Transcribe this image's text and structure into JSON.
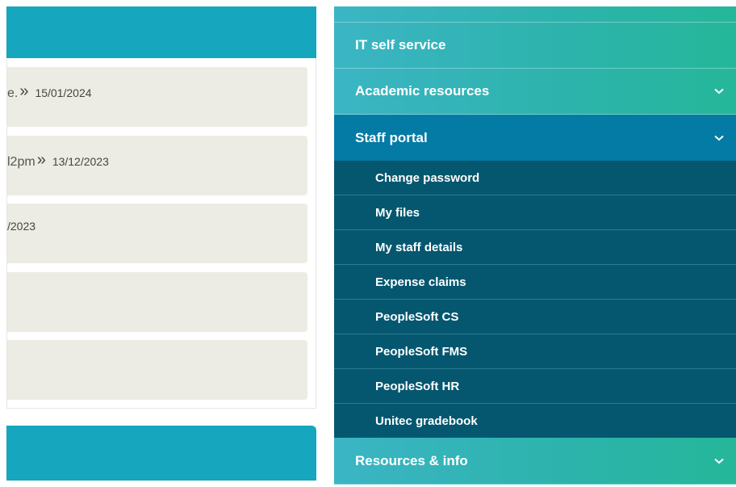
{
  "news": {
    "items": [
      {
        "snippet": "e.",
        "date": "15/01/2024"
      },
      {
        "snippet": "l2pm",
        "date": "13/12/2023"
      },
      {
        "snippet": "",
        "date": "/2023"
      },
      {
        "snippet": "",
        "date": ""
      },
      {
        "snippet": "",
        "date": ""
      }
    ],
    "arrow": "»"
  },
  "nav": {
    "items": [
      {
        "label": "IT self service"
      },
      {
        "label": "Academic resources"
      },
      {
        "label": "Staff portal"
      },
      {
        "label": "Resources & info"
      }
    ],
    "staff_portal_sub": [
      "Change password",
      "My files",
      "My staff details",
      "Expense claims",
      "PeopleSoft CS",
      "PeopleSoft FMS",
      "PeopleSoft HR",
      "Unitec gradebook"
    ]
  },
  "colors": {
    "teal_header": "#16a6bd",
    "card_bg": "#ecece4",
    "nav_active": "#047ba5",
    "submenu_bg": "#055770"
  },
  "icons": {
    "expand": "chevron-down-icon",
    "more": "double-chevron-right-icon"
  }
}
